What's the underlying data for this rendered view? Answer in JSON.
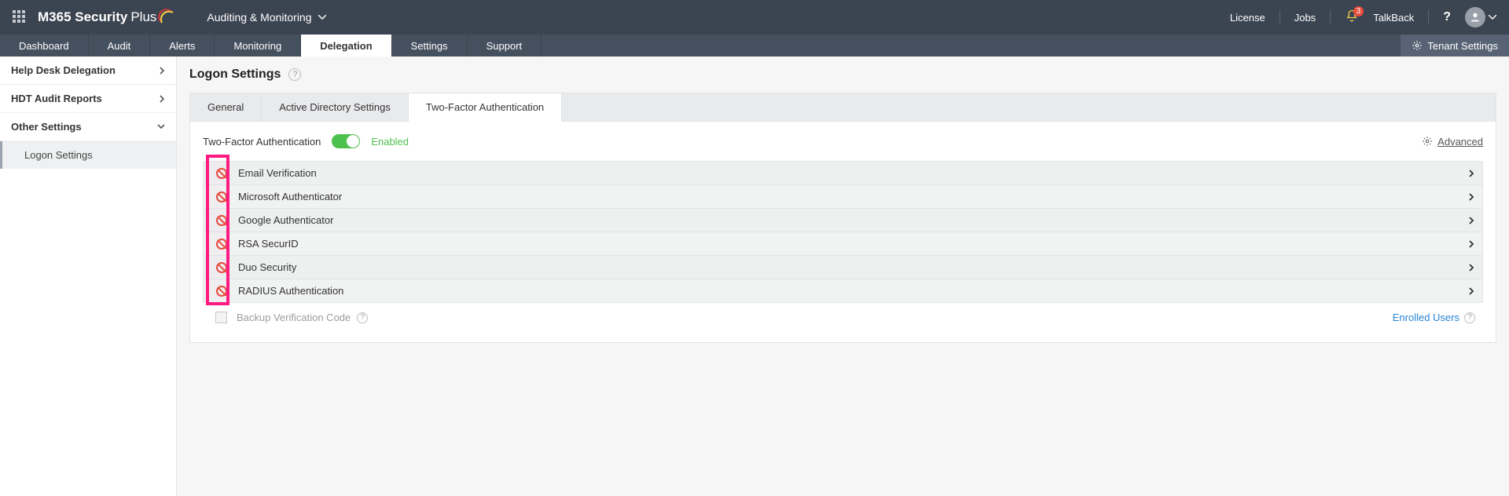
{
  "header": {
    "brand_main": "M365 Security",
    "brand_sub": "Plus",
    "module": "Auditing & Monitoring",
    "notification_count": "3",
    "links": {
      "license": "License",
      "jobs": "Jobs",
      "talkback": "TalkBack"
    }
  },
  "nav": {
    "tabs": [
      {
        "label": "Dashboard"
      },
      {
        "label": "Audit"
      },
      {
        "label": "Alerts"
      },
      {
        "label": "Monitoring"
      },
      {
        "label": "Delegation"
      },
      {
        "label": "Settings"
      },
      {
        "label": "Support"
      }
    ],
    "tenant_settings": "Tenant Settings"
  },
  "sidebar": {
    "items": [
      {
        "label": "Help Desk Delegation"
      },
      {
        "label": "HDT Audit Reports"
      },
      {
        "label": "Other Settings"
      }
    ],
    "sub": {
      "logon_settings": "Logon Settings"
    }
  },
  "page": {
    "title": "Logon Settings",
    "subtabs": [
      {
        "label": "General"
      },
      {
        "label": "Active Directory Settings"
      },
      {
        "label": "Two-Factor Authentication"
      }
    ],
    "tfa_label": "Two-Factor Authentication",
    "tfa_status": "Enabled",
    "advanced": "Advanced",
    "methods": [
      {
        "name": "Email Verification"
      },
      {
        "name": "Microsoft Authenticator"
      },
      {
        "name": "Google Authenticator"
      },
      {
        "name": "RSA SecurID"
      },
      {
        "name": "Duo Security"
      },
      {
        "name": "RADIUS Authentication"
      }
    ],
    "backup_label": "Backup Verification Code",
    "enrolled_users": "Enrolled Users"
  }
}
